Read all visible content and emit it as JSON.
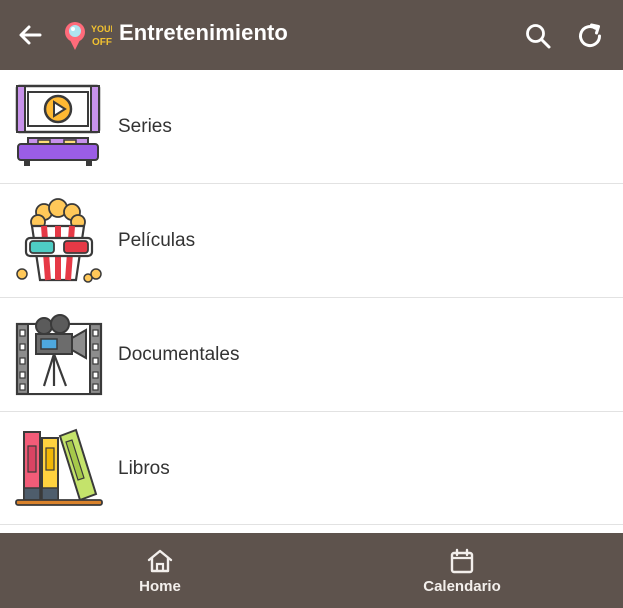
{
  "header": {
    "title": "Entretenimiento",
    "logo_text": "YOUR OFF",
    "back_icon": "arrow-left-icon",
    "search_icon": "search-icon",
    "refresh_icon": "refresh-icon"
  },
  "items": [
    {
      "label": "Series",
      "icon": "tv-sofa-icon"
    },
    {
      "label": "Películas",
      "icon": "popcorn-3d-glasses-icon"
    },
    {
      "label": "Documentales",
      "icon": "film-camera-icon"
    },
    {
      "label": "Libros",
      "icon": "books-icon"
    }
  ],
  "bottom_nav": {
    "home_label": "Home",
    "calendar_label": "Calendario"
  },
  "colors": {
    "bar": "#5e534d",
    "divider": "#e2e2e2",
    "text": "#333333"
  }
}
